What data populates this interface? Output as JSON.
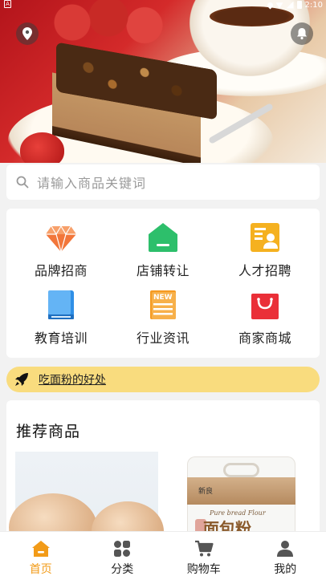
{
  "status_bar": {
    "time": "2:10",
    "icons": [
      "location-icon",
      "wifi-icon",
      "signal-icon",
      "battery-icon"
    ]
  },
  "hero": {
    "icons": [
      "location-pin-icon",
      "bell-icon"
    ]
  },
  "search": {
    "placeholder": "请输入商品关键词",
    "icon": "search-icon"
  },
  "categories": [
    {
      "label": "品牌招商",
      "icon": "diamond-icon",
      "color": "#f2763a"
    },
    {
      "label": "店铺转让",
      "icon": "shop-icon",
      "color": "#2dbf6b"
    },
    {
      "label": "人才招聘",
      "icon": "resume-icon",
      "color": "#f5b120"
    },
    {
      "label": "教育培训",
      "icon": "book-icon",
      "color": "#2f8fe6"
    },
    {
      "label": "行业资讯",
      "icon": "news-icon",
      "color": "#f59a20"
    },
    {
      "label": "商家商城",
      "icon": "shopping-bag-icon",
      "color": "#ea2f38"
    }
  ],
  "notice": {
    "text": "吃面粉的好处",
    "icon": "rocket-icon",
    "bg_color": "#f9dc7e"
  },
  "recommend": {
    "title": "推荐商品",
    "products": [
      {
        "image": "eggs"
      },
      {
        "image": "bread-flour-bag",
        "brand_text": "新良",
        "en_text": "Pure bread Flour",
        "cn_text": "面包粉"
      }
    ]
  },
  "bottom_nav": {
    "items": [
      {
        "label": "首页",
        "icon": "home-icon",
        "active": true
      },
      {
        "label": "分类",
        "icon": "category-icon",
        "active": false
      },
      {
        "label": "购物车",
        "icon": "cart-icon",
        "active": false
      },
      {
        "label": "我的",
        "icon": "user-icon",
        "active": false
      }
    ],
    "active_color": "#f29b18"
  }
}
